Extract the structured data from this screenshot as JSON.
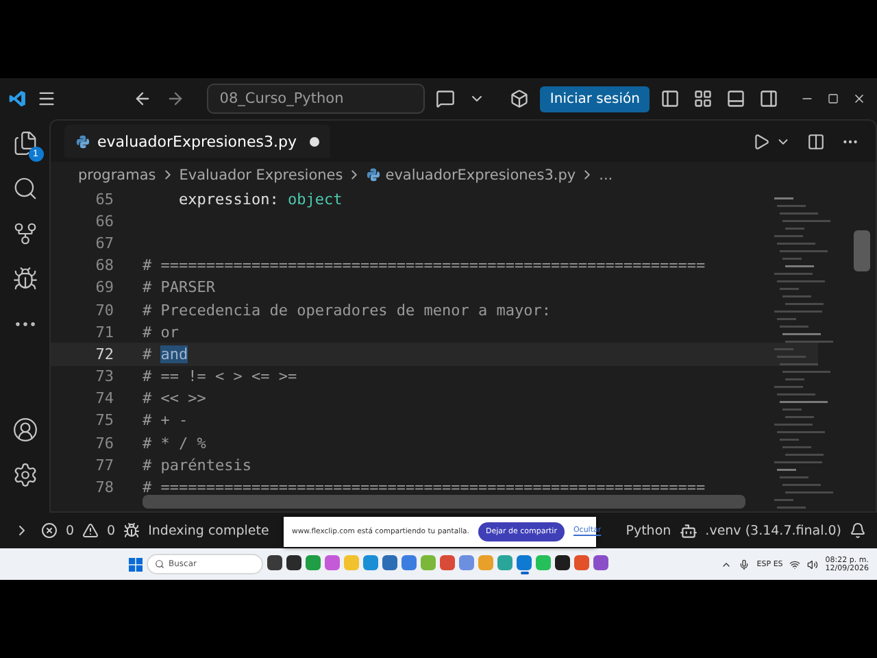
{
  "titlebar": {
    "command_center": "08_Curso_Python",
    "sign_in": "Iniciar sesión"
  },
  "activity_bar": [
    {
      "kind": "files",
      "badge": "1"
    },
    {
      "kind": "search"
    },
    {
      "kind": "source-control"
    },
    {
      "kind": "debug"
    },
    {
      "kind": "more"
    },
    {
      "kind": "account"
    },
    {
      "kind": "settings"
    }
  ],
  "tabs": [
    {
      "label": "evaluadorExpresiones3.py",
      "selected": true,
      "modified": true
    }
  ],
  "breadcrumb": [
    {
      "label": "programas",
      "kind": "folder"
    },
    {
      "label": "Evaluador Expresiones",
      "kind": "folder"
    },
    {
      "label": "evaluadorExpresiones3.py",
      "kind": "python"
    },
    {
      "label": "...",
      "kind": "folder"
    }
  ],
  "code": [
    {
      "number": "65",
      "current": false,
      "segments": [
        {
          "text": "    expression: ",
          "kind": "plain"
        },
        {
          "text": "object",
          "kind": "type"
        }
      ]
    },
    {
      "number": "66",
      "current": false
    },
    {
      "number": "67",
      "current": false
    },
    {
      "number": "68",
      "current": false,
      "segments": [
        {
          "text": "# ============================================================",
          "kind": "comment"
        }
      ]
    },
    {
      "number": "69",
      "current": false,
      "segments": [
        {
          "text": "# PARSER",
          "kind": "comment"
        }
      ]
    },
    {
      "number": "70",
      "current": false,
      "segments": [
        {
          "text": "# Precedencia de operadores de menor a mayor:",
          "kind": "comment"
        }
      ]
    },
    {
      "number": "71",
      "current": false,
      "segments": [
        {
          "text": "# or",
          "kind": "comment"
        }
      ]
    },
    {
      "number": "72",
      "current": true,
      "segments": [
        {
          "text": "# ",
          "kind": "comment"
        },
        {
          "text": "and",
          "kind": "selected"
        }
      ]
    },
    {
      "number": "73",
      "current": false,
      "segments": [
        {
          "text": "# == != < > <= >=",
          "kind": "comment"
        }
      ]
    },
    {
      "number": "74",
      "current": false,
      "segments": [
        {
          "text": "# << >>",
          "kind": "comment"
        }
      ]
    },
    {
      "number": "75",
      "current": false,
      "segments": [
        {
          "text": "# + -",
          "kind": "comment"
        }
      ]
    },
    {
      "number": "76",
      "current": false,
      "segments": [
        {
          "text": "# * / %",
          "kind": "comment"
        }
      ]
    },
    {
      "number": "77",
      "current": false,
      "segments": [
        {
          "text": "# paréntesis",
          "kind": "comment"
        }
      ]
    },
    {
      "number": "78",
      "current": false,
      "segments": [
        {
          "text": "# ============================================================",
          "kind": "comment"
        }
      ]
    }
  ],
  "status_bar": {
    "errors": "0",
    "warnings": "0",
    "message": "Indexing complete",
    "language": "Python",
    "interpreter": ".venv (3.14.7.final.0)"
  },
  "share_banner": {
    "text": "www.flexclip.com está compartiendo tu pantalla.",
    "button": "Dejar de compartir",
    "link": "Ocultar"
  },
  "taskbar": {
    "search_placeholder": "Buscar",
    "language": "ESP ES",
    "time": "08:22 p. m.",
    "date": "12/09/2026",
    "apps": [
      {
        "color": "#3a3a3a",
        "selected": false
      },
      {
        "color": "#2b2b2b",
        "selected": false
      },
      {
        "color": "#1f9e45",
        "selected": false
      },
      {
        "color": "#c45ad8",
        "selected": false
      },
      {
        "color": "#f2c12e",
        "selected": false
      },
      {
        "color": "#1a8fd6",
        "selected": false
      },
      {
        "color": "#2d6db5",
        "selected": false
      },
      {
        "color": "#3c7ee0",
        "selected": false
      },
      {
        "color": "#7bb83a",
        "selected": false
      },
      {
        "color": "#d94a38",
        "selected": false
      },
      {
        "color": "#6d8fe0",
        "selected": false
      },
      {
        "color": "#e8a02a",
        "selected": false
      },
      {
        "color": "#2aa59a",
        "selected": false
      },
      {
        "color": "#0f7ad1",
        "selected": true
      },
      {
        "color": "#25c05a",
        "selected": false
      },
      {
        "color": "#1e1e1e",
        "selected": false
      },
      {
        "color": "#e2512a",
        "selected": false
      },
      {
        "color": "#8a4fc8",
        "selected": false
      }
    ]
  }
}
